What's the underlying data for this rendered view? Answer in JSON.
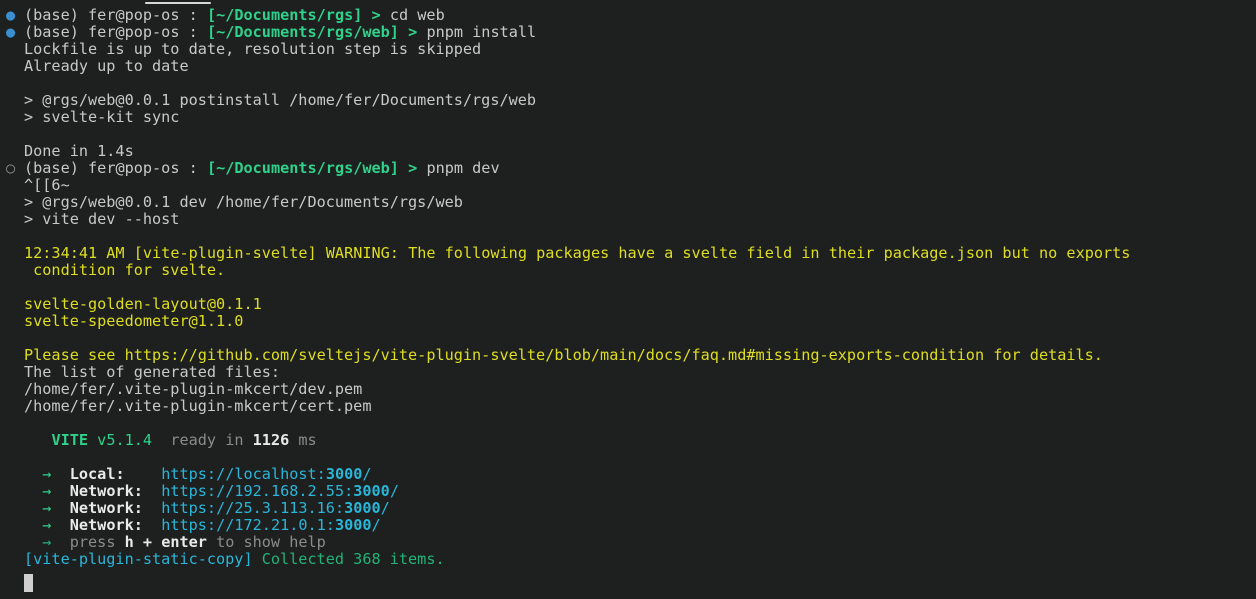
{
  "window": {
    "title": "terminal",
    "background_color": "#1e1f1f",
    "foreground_color": "#c8c8c8",
    "top_indicator": "scroll-indicator"
  },
  "colors": {
    "prompt_path": "#2fd18b",
    "prompt_arrow": "#2fd18b",
    "bullet_success": "#3a8fd0",
    "bullet_running": "#8a8a8a",
    "warning": "#dede20",
    "url": "#29b6d8",
    "vite_brand": "#2fd18b",
    "dim": "#8b8b8b",
    "bright_white": "#eaeaea"
  },
  "session": {
    "conda_env": "(base)",
    "user_host": "fer@pop-os",
    "separator": ":"
  },
  "prompts": [
    {
      "status_icon": "filled-circle",
      "env": "(base)",
      "user_host": "fer@pop-os",
      "path": "[~/Documents/rgs]",
      "arrow": ">",
      "command": "cd web"
    },
    {
      "status_icon": "filled-circle",
      "env": "(base)",
      "user_host": "fer@pop-os",
      "path": "[~/Documents/rgs/web]",
      "arrow": ">",
      "command": "pnpm install"
    },
    {
      "status_icon": "hollow-circle",
      "env": "(base)",
      "user_host": "fer@pop-os",
      "path": "[~/Documents/rgs/web]",
      "arrow": ">",
      "command": "pnpm dev"
    }
  ],
  "output": {
    "lockfile_line": "Lockfile is up to date, resolution step is skipped",
    "already_up_to_date": "Already up to date",
    "postinstall_script": "> @rgs/web@0.0.1 postinstall /home/fer/Documents/rgs/web",
    "svelte_kit_sync": "> svelte-kit sync",
    "done_in": "Done in 1.4s",
    "escape_sequence": "^[[6~",
    "dev_script": "> @rgs/web@0.0.1 dev /home/fer/Documents/rgs/web",
    "vite_dev_host": "> vite dev --host"
  },
  "warning": {
    "timestamp": "12:34:41 AM",
    "plugin": "[vite-plugin-svelte]",
    "level": "WARNING:",
    "message_line1": "The following packages have a svelte field in their package.json but no exports",
    "message_line2": " condition for svelte.",
    "packages": [
      "svelte-golden-layout@0.1.1",
      "svelte-speedometer@1.1.0"
    ],
    "please_see": "Please see https://github.com/sveltejs/vite-plugin-svelte/blob/main/docs/faq.md#missing-exports-condition for details."
  },
  "mkcert": {
    "header": "The list of generated files:",
    "files": [
      "/home/fer/.vite-plugin-mkcert/dev.pem",
      "/home/fer/.vite-plugin-mkcert/cert.pem"
    ]
  },
  "vite": {
    "brand": "VITE",
    "version": "v5.1.4",
    "ready_label": "ready in",
    "ready_ms": "1126",
    "ms_unit": "ms",
    "arrow": "→",
    "servers": [
      {
        "label": "Local:",
        "label_pad": "   ",
        "url_prefix": "https://localhost:",
        "port": "3000",
        "url_suffix": "/"
      },
      {
        "label": "Network:",
        "label_pad": " ",
        "url_prefix": "https://192.168.2.55:",
        "port": "3000",
        "url_suffix": "/"
      },
      {
        "label": "Network:",
        "label_pad": " ",
        "url_prefix": "https://25.3.113.16:",
        "port": "3000",
        "url_suffix": "/"
      },
      {
        "label": "Network:",
        "label_pad": " ",
        "url_prefix": "https://172.21.0.1:",
        "port": "3000",
        "url_suffix": "/"
      }
    ],
    "help_hint": {
      "prefix": "press ",
      "keys": "h + enter",
      "suffix": " to show help"
    }
  },
  "static_copy": {
    "plugin": "[vite-plugin-static-copy]",
    "message": " Collected 368 items."
  },
  "cursor": {
    "shape": "block",
    "state": "visible"
  }
}
